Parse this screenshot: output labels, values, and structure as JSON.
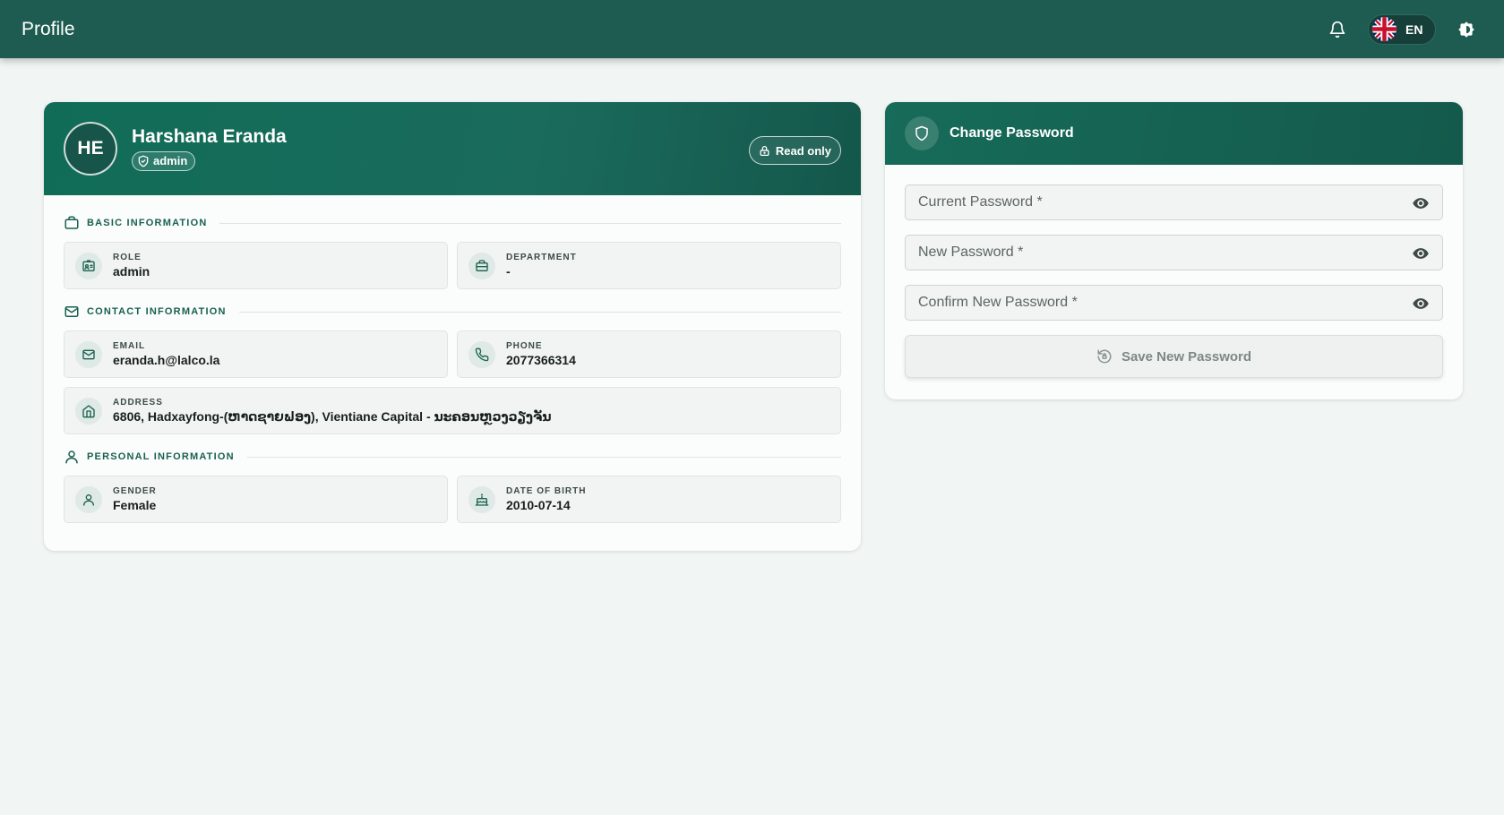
{
  "topbar": {
    "title": "Profile",
    "language_code": "EN"
  },
  "profile": {
    "initials": "HE",
    "name": "Harshana Eranda",
    "role_badge": "admin",
    "read_only_label": "Read only",
    "sections": {
      "basic": "BASIC INFORMATION",
      "contact": "CONTACT INFORMATION",
      "personal": "PERSONAL INFORMATION"
    },
    "fields": {
      "role": {
        "label": "ROLE",
        "value": "admin"
      },
      "department": {
        "label": "DEPARTMENT",
        "value": "-"
      },
      "email": {
        "label": "EMAIL",
        "value": "eranda.h@lalco.la"
      },
      "phone": {
        "label": "PHONE",
        "value": "2077366314"
      },
      "address": {
        "label": "ADDRESS",
        "value": "6806, Hadxayfong-(ຫາດຊາຍຟອງ), Vientiane Capital - ນະຄອນຫຼວງວຽງຈັນ"
      },
      "gender": {
        "label": "GENDER",
        "value": "Female"
      },
      "dob": {
        "label": "DATE OF BIRTH",
        "value": "2010-07-14"
      }
    }
  },
  "password": {
    "title": "Change Password",
    "current_placeholder": "Current Password *",
    "new_placeholder": "New Password *",
    "confirm_placeholder": "Confirm New Password *",
    "save_label": "Save New Password"
  },
  "colors": {
    "topbar": "#1e5c51",
    "accent": "#19614f",
    "background": "#f1f5f3"
  }
}
